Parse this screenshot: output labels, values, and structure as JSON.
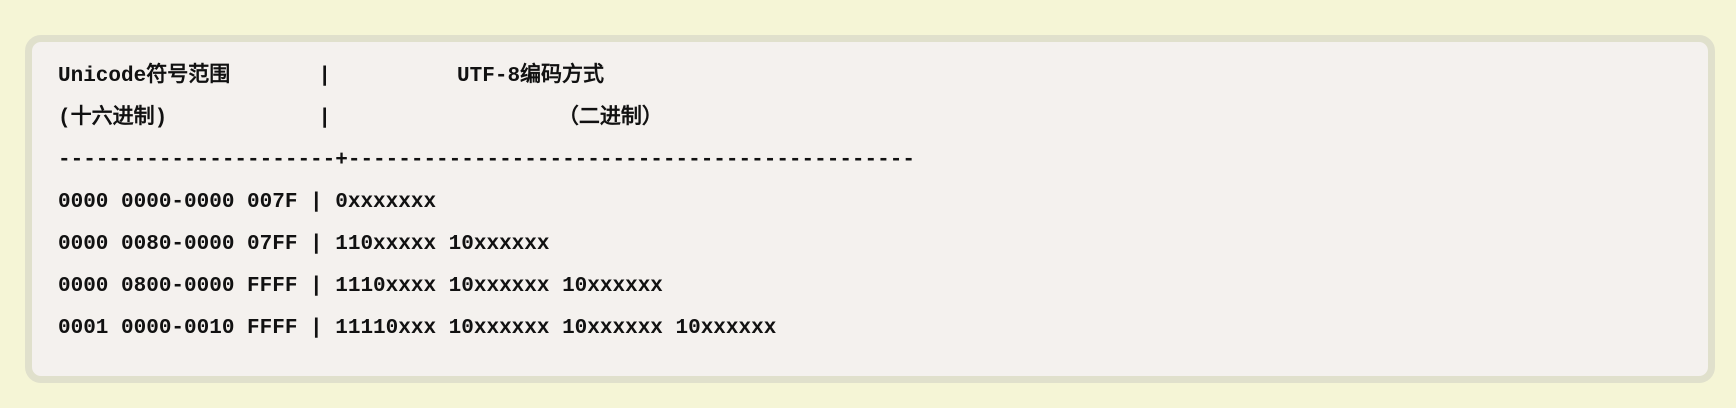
{
  "code_block": {
    "lines": [
      "Unicode符号范围       |          UTF-8编码方式",
      "(十六进制)            |                  （二进制）",
      "----------------------+---------------------------------------------",
      "0000 0000-0000 007F | 0xxxxxxx",
      "0000 0080-0000 07FF | 110xxxxx 10xxxxxx",
      "0000 0800-0000 FFFF | 1110xxxx 10xxxxxx 10xxxxxx",
      "0001 0000-0010 FFFF | 11110xxx 10xxxxxx 10xxxxxx 10xxxxxx"
    ]
  }
}
